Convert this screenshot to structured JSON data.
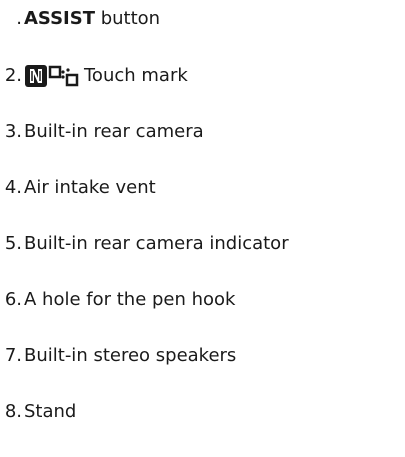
{
  "list": {
    "items": [
      {
        "num": ".",
        "bold": "ASSIST",
        "text": " button"
      },
      {
        "num": "2.",
        "icon_names": [
          "nfc-n-mark-icon",
          "one-touch-mirroring-icon"
        ],
        "text": "Touch mark"
      },
      {
        "num": "3.",
        "text": "Built-in rear camera"
      },
      {
        "num": "4.",
        "text": "Air intake vent"
      },
      {
        "num": "5.",
        "text": "Built-in rear camera indicator"
      },
      {
        "num": "6.",
        "text": "A hole for the pen hook"
      },
      {
        "num": "7.",
        "text": "Built-in stereo speakers"
      },
      {
        "num": "8.",
        "text": "Stand"
      }
    ]
  }
}
